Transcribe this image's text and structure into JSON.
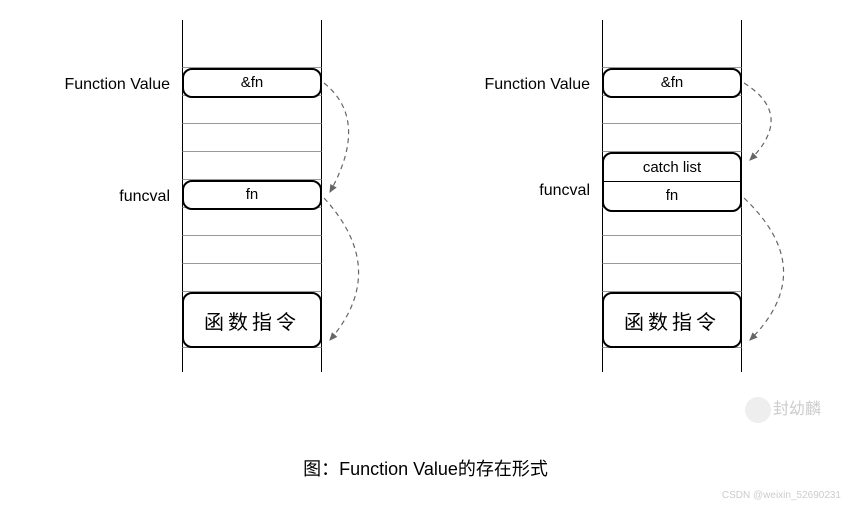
{
  "left": {
    "label_fv": "Function Value",
    "box_fv": "&fn",
    "label_funcval": "funcval",
    "box_funcval": "fn",
    "instruction": "函数指令"
  },
  "right": {
    "label_fv": "Function Value",
    "box_fv": "&fn",
    "label_funcval": "funcval",
    "box_catch": "catch list",
    "box_funcval": "fn",
    "instruction": "函数指令"
  },
  "caption": "图：Function Value的存在形式",
  "watermark": "封幼麟",
  "credit": "CSDN @weixin_52690231"
}
